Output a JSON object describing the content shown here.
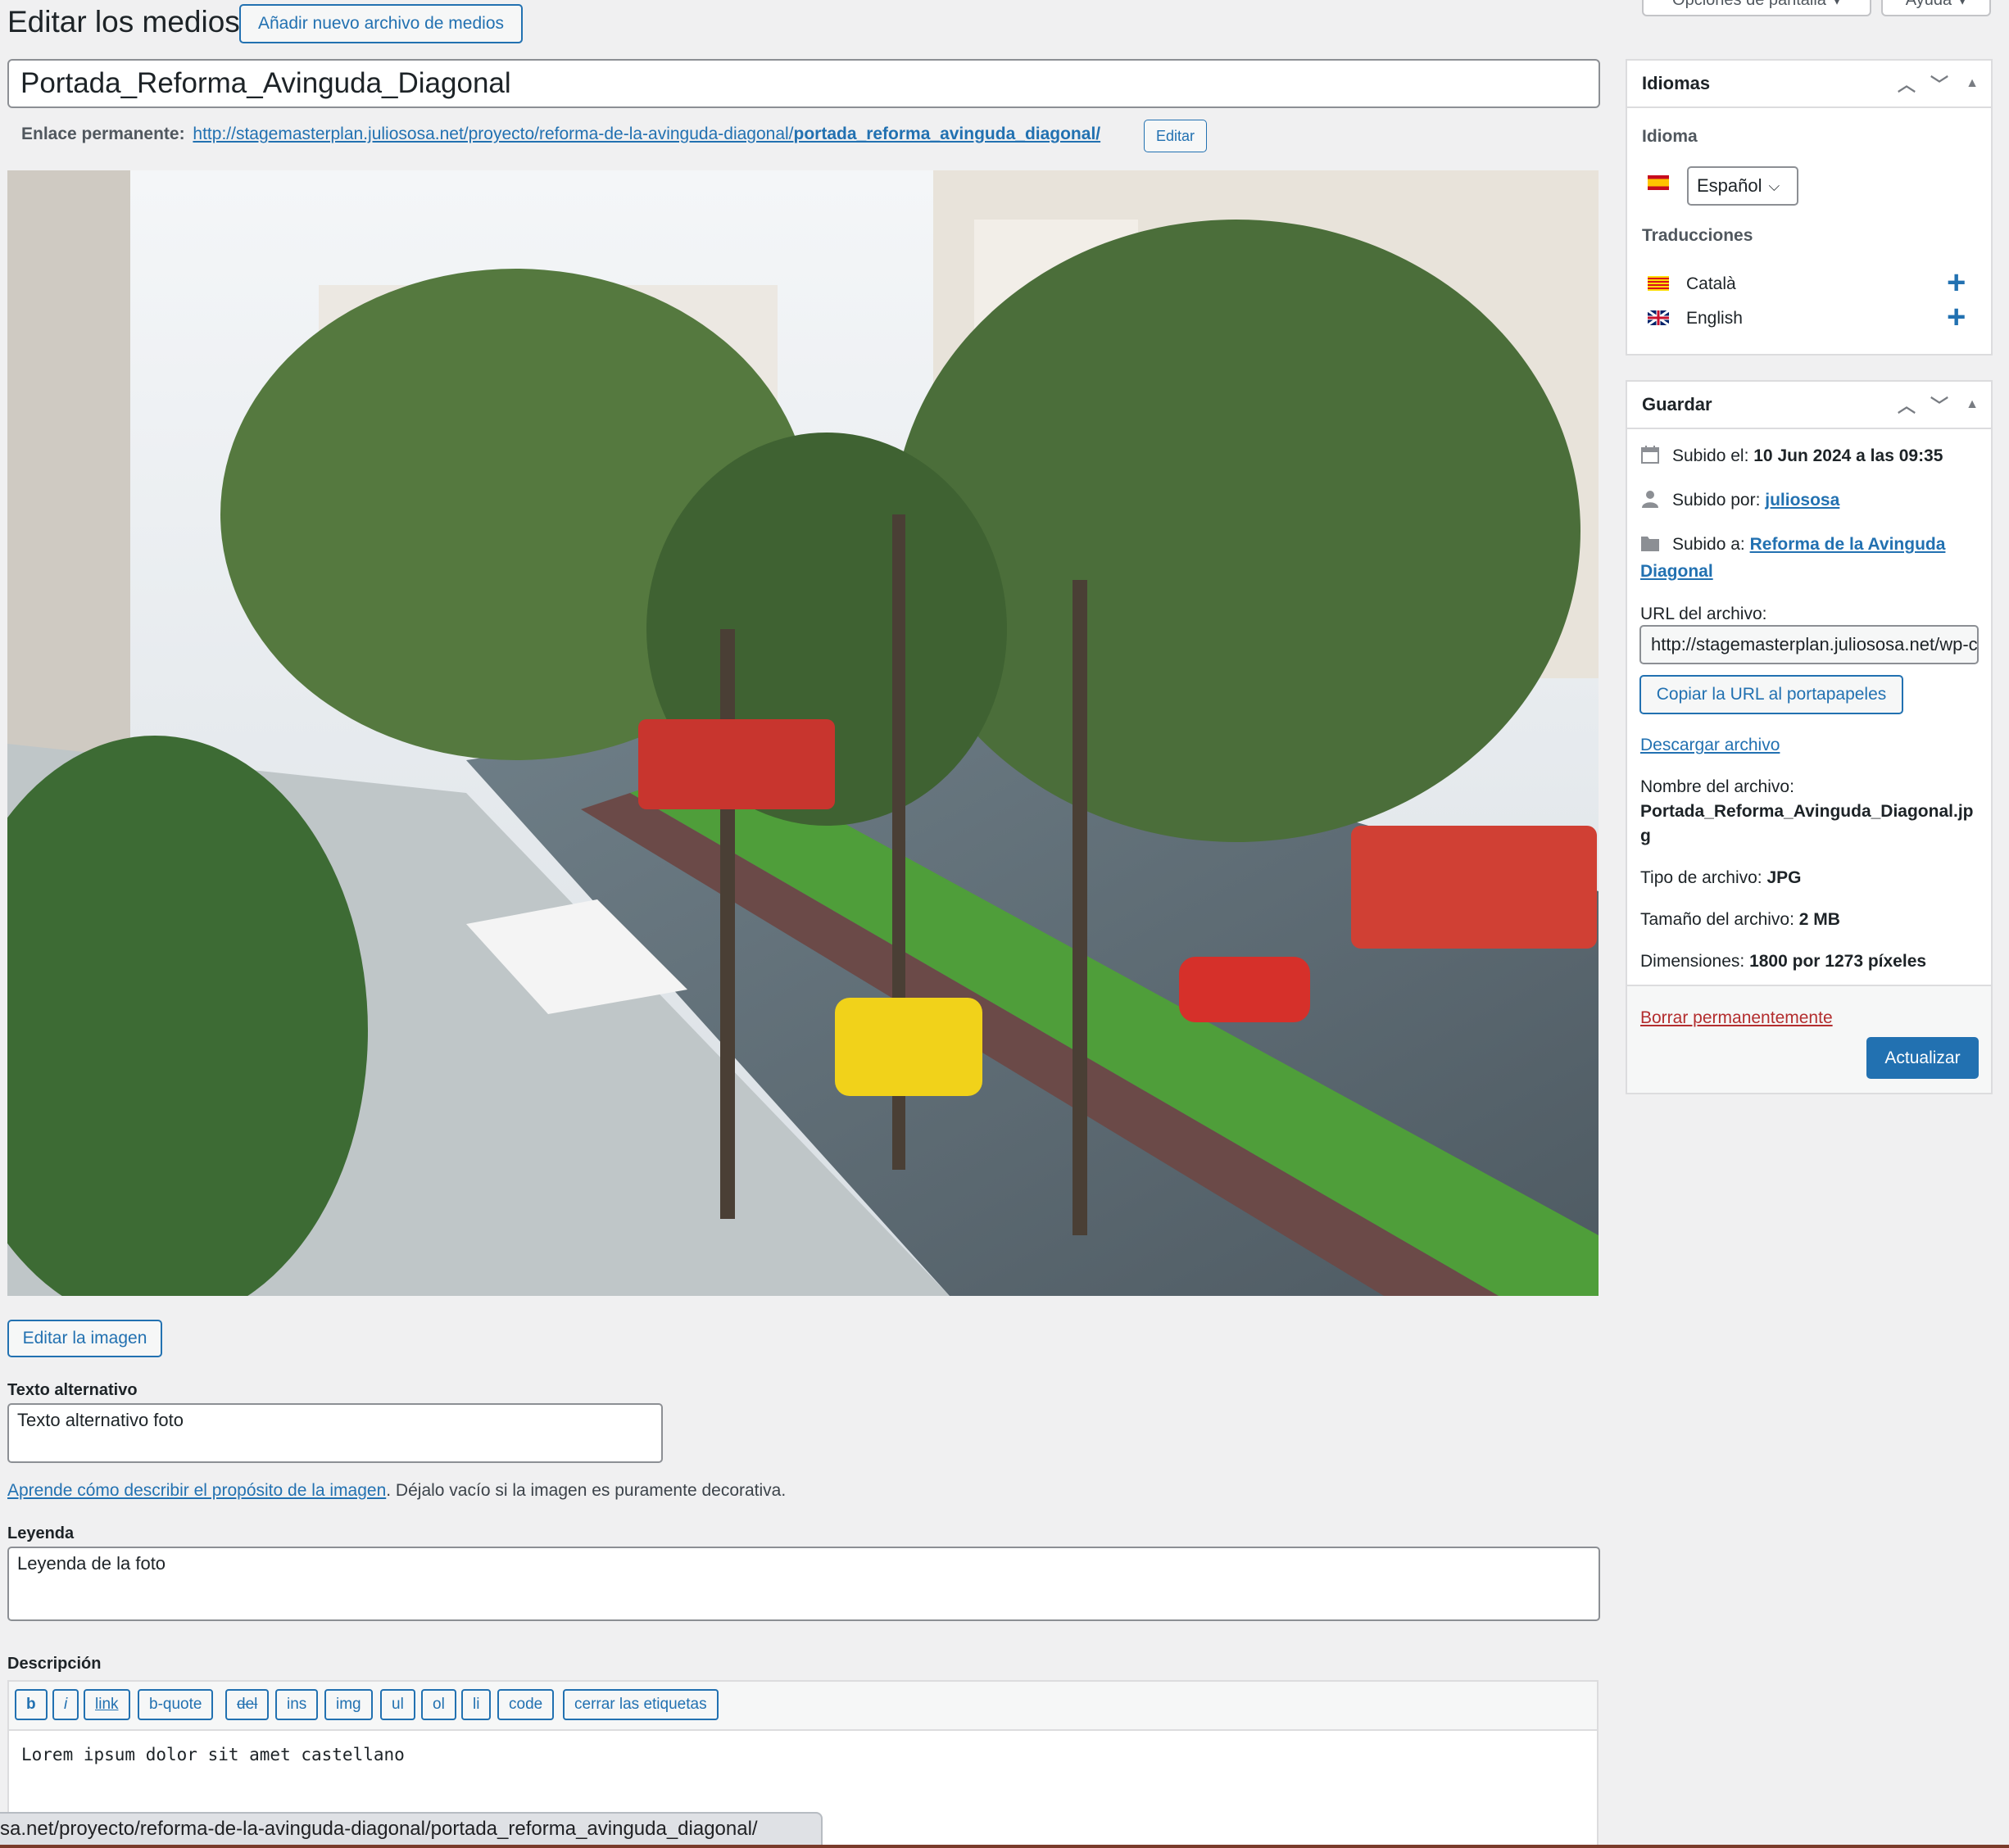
{
  "header": {
    "title": "Editar los medios",
    "add_new_label": "Añadir nuevo archivo de medios",
    "screen_options_label": "Opciones de pantalla",
    "help_label": "Ayuda"
  },
  "post": {
    "title_value": "Portada_Reforma_Avinguda_Diagonal",
    "permalink_label": "Enlace permanente:",
    "permalink_base": "http://stagemasterplan.juliososa.net/proyecto/reforma-de-la-avinguda-diagonal/",
    "permalink_slug": "portada_reforma_avinguda_diagonal/",
    "permalink_edit_label": "Editar"
  },
  "image": {
    "edit_button_label": "Editar la imagen"
  },
  "alt_text": {
    "label": "Texto alternativo",
    "value": "Texto alternativo foto",
    "help_link": "Aprende cómo describir el propósito de la imagen",
    "help_text": ". Déjalo vacío si la imagen es puramente decorativa."
  },
  "caption": {
    "label": "Leyenda",
    "value": "Leyenda de la foto"
  },
  "description": {
    "label": "Descripción",
    "toolbar": [
      "b",
      "i",
      "link",
      "b-quote",
      "del",
      "ins",
      "img",
      "ul",
      "ol",
      "li",
      "code",
      "cerrar las etiquetas"
    ],
    "value": "Lorem ipsum dolor sit amet castellano"
  },
  "status_bar": {
    "url": "sa.net/proyecto/reforma-de-la-avinguda-diagonal/portada_reforma_avinguda_diagonal/"
  },
  "languages_panel": {
    "title": "Idiomas",
    "language_label": "Idioma",
    "selected_language": "Español",
    "translations_label": "Traducciones",
    "translations": [
      {
        "name": "Català",
        "icon": "catalan-flag-icon"
      },
      {
        "name": "English",
        "icon": "uk-flag-icon"
      }
    ]
  },
  "save_panel": {
    "title": "Guardar",
    "uploaded_on_label": "Subido el:",
    "uploaded_on_value": "10 Jun 2024 a las 09:35",
    "uploaded_by_label": "Subido por:",
    "uploaded_by_value": "juliososa",
    "uploaded_to_label": "Subido a:",
    "uploaded_to_value_line1": "Reforma de la Avinguda",
    "uploaded_to_value_line2": "Diagonal",
    "file_url_label": "URL del archivo:",
    "file_url_value": "http://stagemasterplan.juliososa.net/wp-content/uploads/Portada_Reforma_Avinguda_Diagonal.jpg",
    "copy_url_label": "Copiar la URL al portapapeles",
    "download_label": "Descargar archivo",
    "file_name_label": "Nombre del archivo:",
    "file_name_line1": "Portada_Reforma_Avinguda_Diagonal.jp",
    "file_name_line2": "g",
    "file_type_label": "Tipo de archivo:",
    "file_type_value": "JPG",
    "file_size_label": "Tamaño del archivo:",
    "file_size_value": "2 MB",
    "dimensions_label": "Dimensiones:",
    "dimensions_value": "1800 por 1273 píxeles",
    "delete_label": "Borrar permanentemente",
    "update_label": "Actualizar"
  },
  "colors": {
    "accent": "#2271b1",
    "delete": "#b32d2e",
    "background": "#f0f0f1"
  }
}
